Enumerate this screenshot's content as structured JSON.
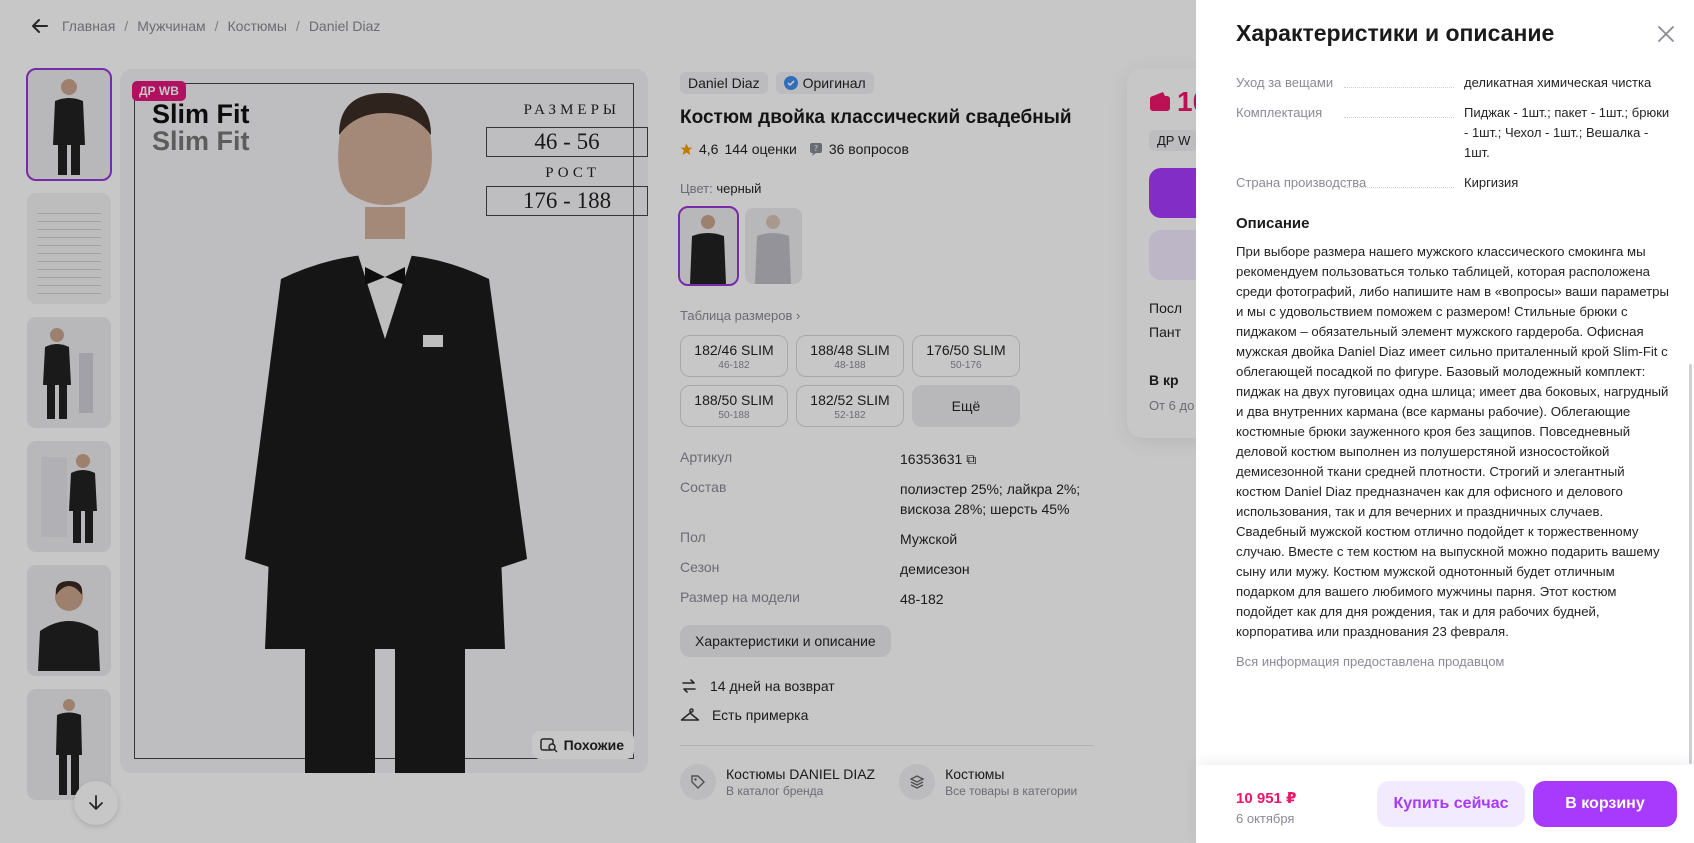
{
  "breadcrumbs": [
    "Главная",
    "Мужчинам",
    "Костюмы",
    "Daniel Diaz"
  ],
  "gallery": {
    "badge": "ДР WB",
    "title_line1": "Slim Fit",
    "title_line2": "Slim Fit",
    "sizes_label": "РАЗМЕРЫ",
    "sizes_value": "46 - 56",
    "height_label": "РОСТ",
    "height_value": "176 - 188",
    "similar_label": "Похожие"
  },
  "product": {
    "brand": "Daniel Diaz",
    "original_label": "Оригинал",
    "title": "Костюм двойка классический свадебный",
    "rating": "4,6",
    "reviews": "144 оценки",
    "questions": "36 вопросов",
    "color_label": "Цвет:",
    "color_value": "черный",
    "size_table_link": "Таблица размеров",
    "sizes": [
      {
        "size": "182/46 SLIM",
        "range": "46-182"
      },
      {
        "size": "188/48 SLIM",
        "range": "48-188"
      },
      {
        "size": "176/50 SLIM",
        "range": "50-176"
      },
      {
        "size": "188/50 SLIM",
        "range": "50-188"
      },
      {
        "size": "182/52 SLIM",
        "range": "52-182"
      }
    ],
    "more_sizes": "Ещё",
    "specs": [
      {
        "k": "Артикул",
        "v": "16353631"
      },
      {
        "k": "Состав",
        "v": "полиэстер 25%; лайкра 2%; вискоза 28%; шерсть 45%"
      },
      {
        "k": "Пол",
        "v": "Мужской"
      },
      {
        "k": "Сезон",
        "v": "демисезон"
      },
      {
        "k": "Размер на модели",
        "v": "48-182"
      }
    ],
    "char_button": "Характеристики и описание",
    "return_text": "14 дней на возврат",
    "fitting_text": "Есть примерка",
    "catalogs": [
      {
        "title": "Костюмы DANIEL DIAZ",
        "sub": "В каталог бренда"
      },
      {
        "title": "Костюмы",
        "sub": "Все товары в категории"
      }
    ]
  },
  "buybox": {
    "price": "10",
    "dr_chip": "ДР W",
    "line1": "Посл",
    "line2": "Пант",
    "line3": "В кр",
    "line4": "От 6 до"
  },
  "drawer": {
    "title": "Характеристики и описание",
    "rows": [
      {
        "k": "Уход за вещами",
        "v": "деликатная химическая чистка"
      },
      {
        "k": "Комплектация",
        "v": "Пиджак - 1шт.; пакет - 1шт.; брюки - 1шт.; Чехол - 1шт.; Вешалка - 1шт."
      },
      {
        "k": "Страна производства",
        "v": "Киргизия"
      }
    ],
    "desc_heading": "Описание",
    "description": "При выборе размера нашего мужского классического смокинга мы рекомендуем пользоваться только таблицей, которая расположена среди фотографий, либо напишите нам в «вопросы» ваши параметры и мы с удовольствием поможем с размером! Стильные брюки с пиджаком – обязательный элемент мужского гардероба. Офисная мужская двойка Daniel Diaz имеет сильно приталенный крой Slim-Fit с облегающей посадкой по фигуре. Базовый молодежный комплект: пиджак на двух пуговицах одна шлица; имеет два боковых, нагрудный и два внутренних кармана (все карманы рабочие). Облегающие костюмные брюки зауженного кроя без защипов. Повседневный деловой костюм выполнен из полушерстяной износостойкой демисезонной ткани средней плотности. Строгий и элегантный костюм Daniel Diaz предназначен как для офисного и делового использования, так и для вечерних и праздничных случаев. Свадебный мужской костюм отлично подойдет к торжественному случаю. Вместе с тем костюм на выпускной можно подарить вашему сыну или мужу. Костюм мужской однотонный будет отличным подарком для вашего любимого мужчины парня. Этот костюм подойдет как для дня рождения, так и для рабочих будней, корпоратива или празднования 23 февраля.",
    "seller_note": "Вся информация предоставлена продавцом",
    "footer_price": "10 951 ₽",
    "footer_date": "6 октября",
    "buy_now": "Купить сейчас",
    "to_cart": "В корзину"
  },
  "colors": {
    "accent": "#a73afd",
    "price": "#f0156b",
    "badge": "#e5157c"
  }
}
